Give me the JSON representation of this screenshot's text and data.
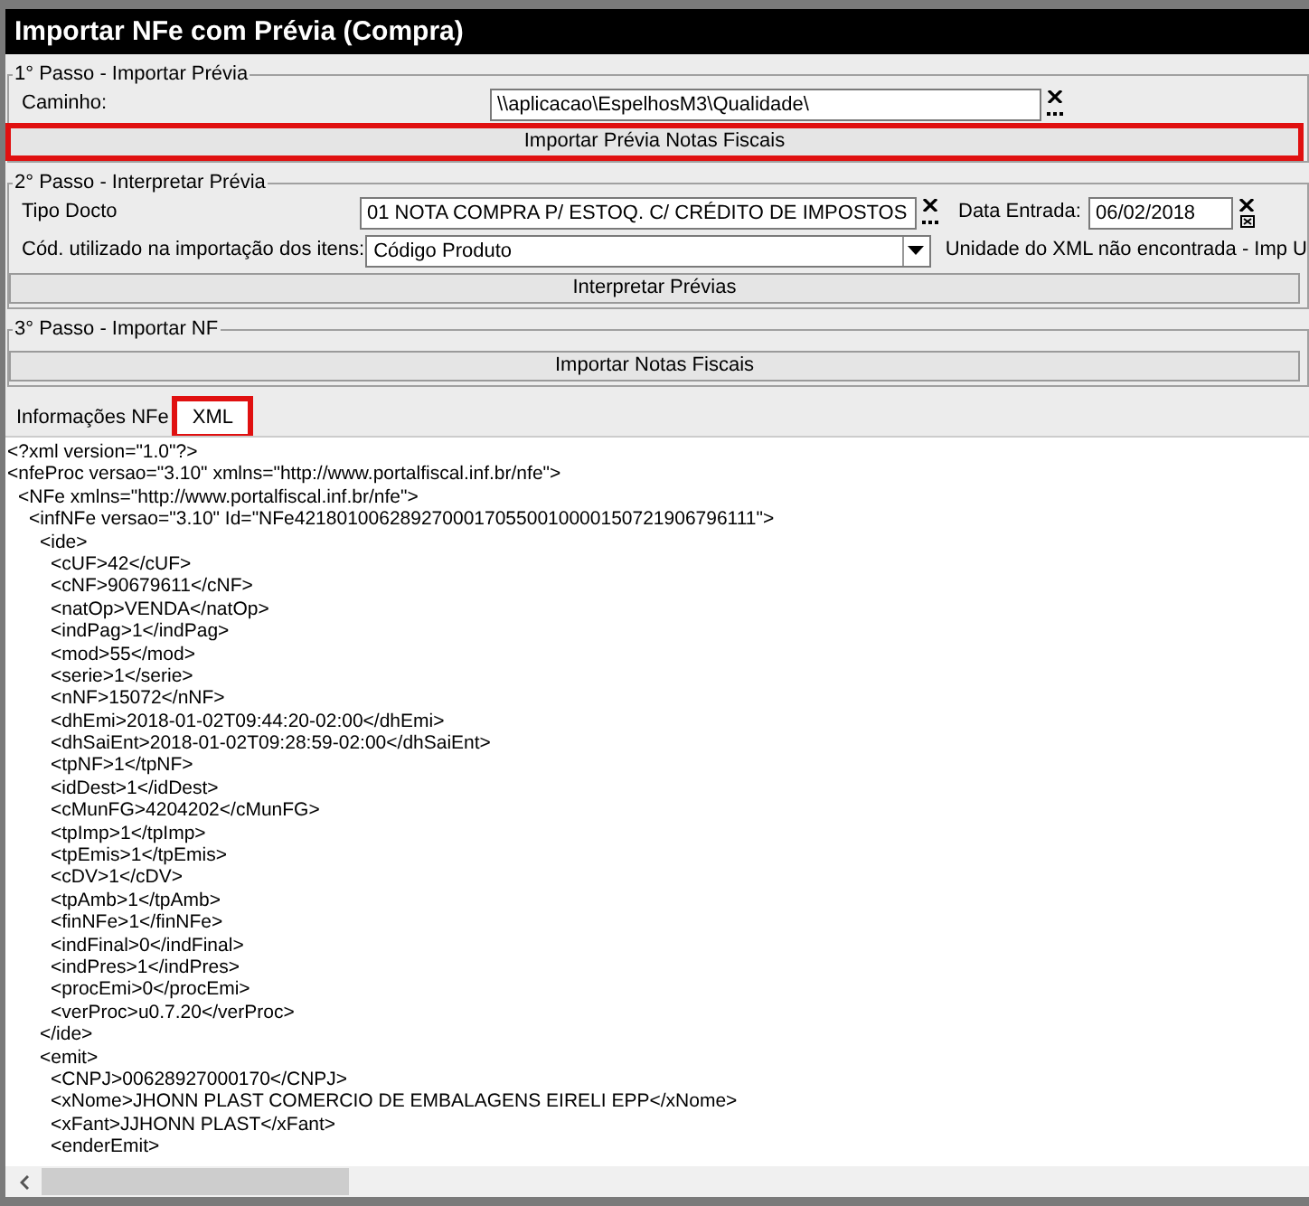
{
  "window": {
    "title": "Importar NFe com Prévia (Compra)"
  },
  "step1": {
    "legend": "1° Passo - Importar Prévia",
    "path_label": "Caminho:",
    "path_value": "\\\\aplicacao\\EspelhosM3\\Qualidade\\",
    "button": {
      "label": "Importar Prévia Notas Fiscais",
      "highlighted": true
    }
  },
  "step2": {
    "legend": "2° Passo - Interpretar Prévia",
    "doc_type_label": "Tipo Docto",
    "doc_type_value": "01 NOTA COMPRA P/ ESTOQ. C/ CRÉDITO DE IMPOSTOS",
    "date_label": "Data Entrada:",
    "date_value": "06/02/2018",
    "code_label": "Cód. utilizado na importação dos itens:",
    "code_value": "Código Produto",
    "message": "Unidade do XML não encontrada - Imp U",
    "button": {
      "label": "Interpretar Prévias",
      "highlighted": false
    }
  },
  "step3": {
    "legend": "3° Passo - Importar NF",
    "button": {
      "label": "Importar Notas Fiscais",
      "highlighted": false
    }
  },
  "tabs": [
    {
      "label": "Informações NFe",
      "selected": false,
      "highlighted": false
    },
    {
      "label": "XML",
      "selected": true,
      "highlighted": true
    }
  ],
  "xml_lines": [
    {
      "text": "<?xml version=\"1.0\"?>"
    },
    {
      "text": "<nfeProc versao=\"3.10\" xmlns=\"http://www.portalfiscal.inf.br/nfe\">",
      "children": [
        {
          "text": "<NFe xmlns=\"http://www.portalfiscal.inf.br/nfe\">",
          "children": [
            {
              "text": "<infNFe versao=\"3.10\" Id=\"NFe42180100628927000170550010000150721906796111\">",
              "children": [
                {
                  "text": "<ide>",
                  "children": [
                    {
                      "text": "<cUF>42</cUF>"
                    },
                    {
                      "text": "<cNF>90679611</cNF>"
                    },
                    {
                      "text": "<natOp>VENDA</natOp>"
                    },
                    {
                      "text": "<indPag>1</indPag>"
                    },
                    {
                      "text": "<mod>55</mod>"
                    },
                    {
                      "text": "<serie>1</serie>"
                    },
                    {
                      "text": "<nNF>15072</nNF>"
                    },
                    {
                      "text": "<dhEmi>2018-01-02T09:44:20-02:00</dhEmi>"
                    },
                    {
                      "text": "<dhSaiEnt>2018-01-02T09:28:59-02:00</dhSaiEnt>"
                    },
                    {
                      "text": "<tpNF>1</tpNF>"
                    },
                    {
                      "text": "<idDest>1</idDest>"
                    },
                    {
                      "text": "<cMunFG>4204202</cMunFG>"
                    },
                    {
                      "text": "<tpImp>1</tpImp>"
                    },
                    {
                      "text": "<tpEmis>1</tpEmis>"
                    },
                    {
                      "text": "<cDV>1</cDV>"
                    },
                    {
                      "text": "<tpAmb>1</tpAmb>"
                    },
                    {
                      "text": "<finNFe>1</finNFe>"
                    },
                    {
                      "text": "<indFinal>0</indFinal>"
                    },
                    {
                      "text": "<indPres>1</indPres>"
                    },
                    {
                      "text": "<procEmi>0</procEmi>"
                    },
                    {
                      "text": "<verProc>u0.7.20</verProc>"
                    }
                  ]
                },
                {
                  "text": "</ide>"
                },
                {
                  "text": "<emit>",
                  "children": [
                    {
                      "text": "<CNPJ>00628927000170</CNPJ>"
                    },
                    {
                      "text": "<xNome>JHONN PLAST COMERCIO DE EMBALAGENS EIRELI EPP</xNome>"
                    },
                    {
                      "text": "<xFant>JJHONN PLAST</xFant>"
                    },
                    {
                      "text": "<enderEmit>"
                    }
                  ]
                }
              ]
            }
          ]
        }
      ]
    }
  ]
}
